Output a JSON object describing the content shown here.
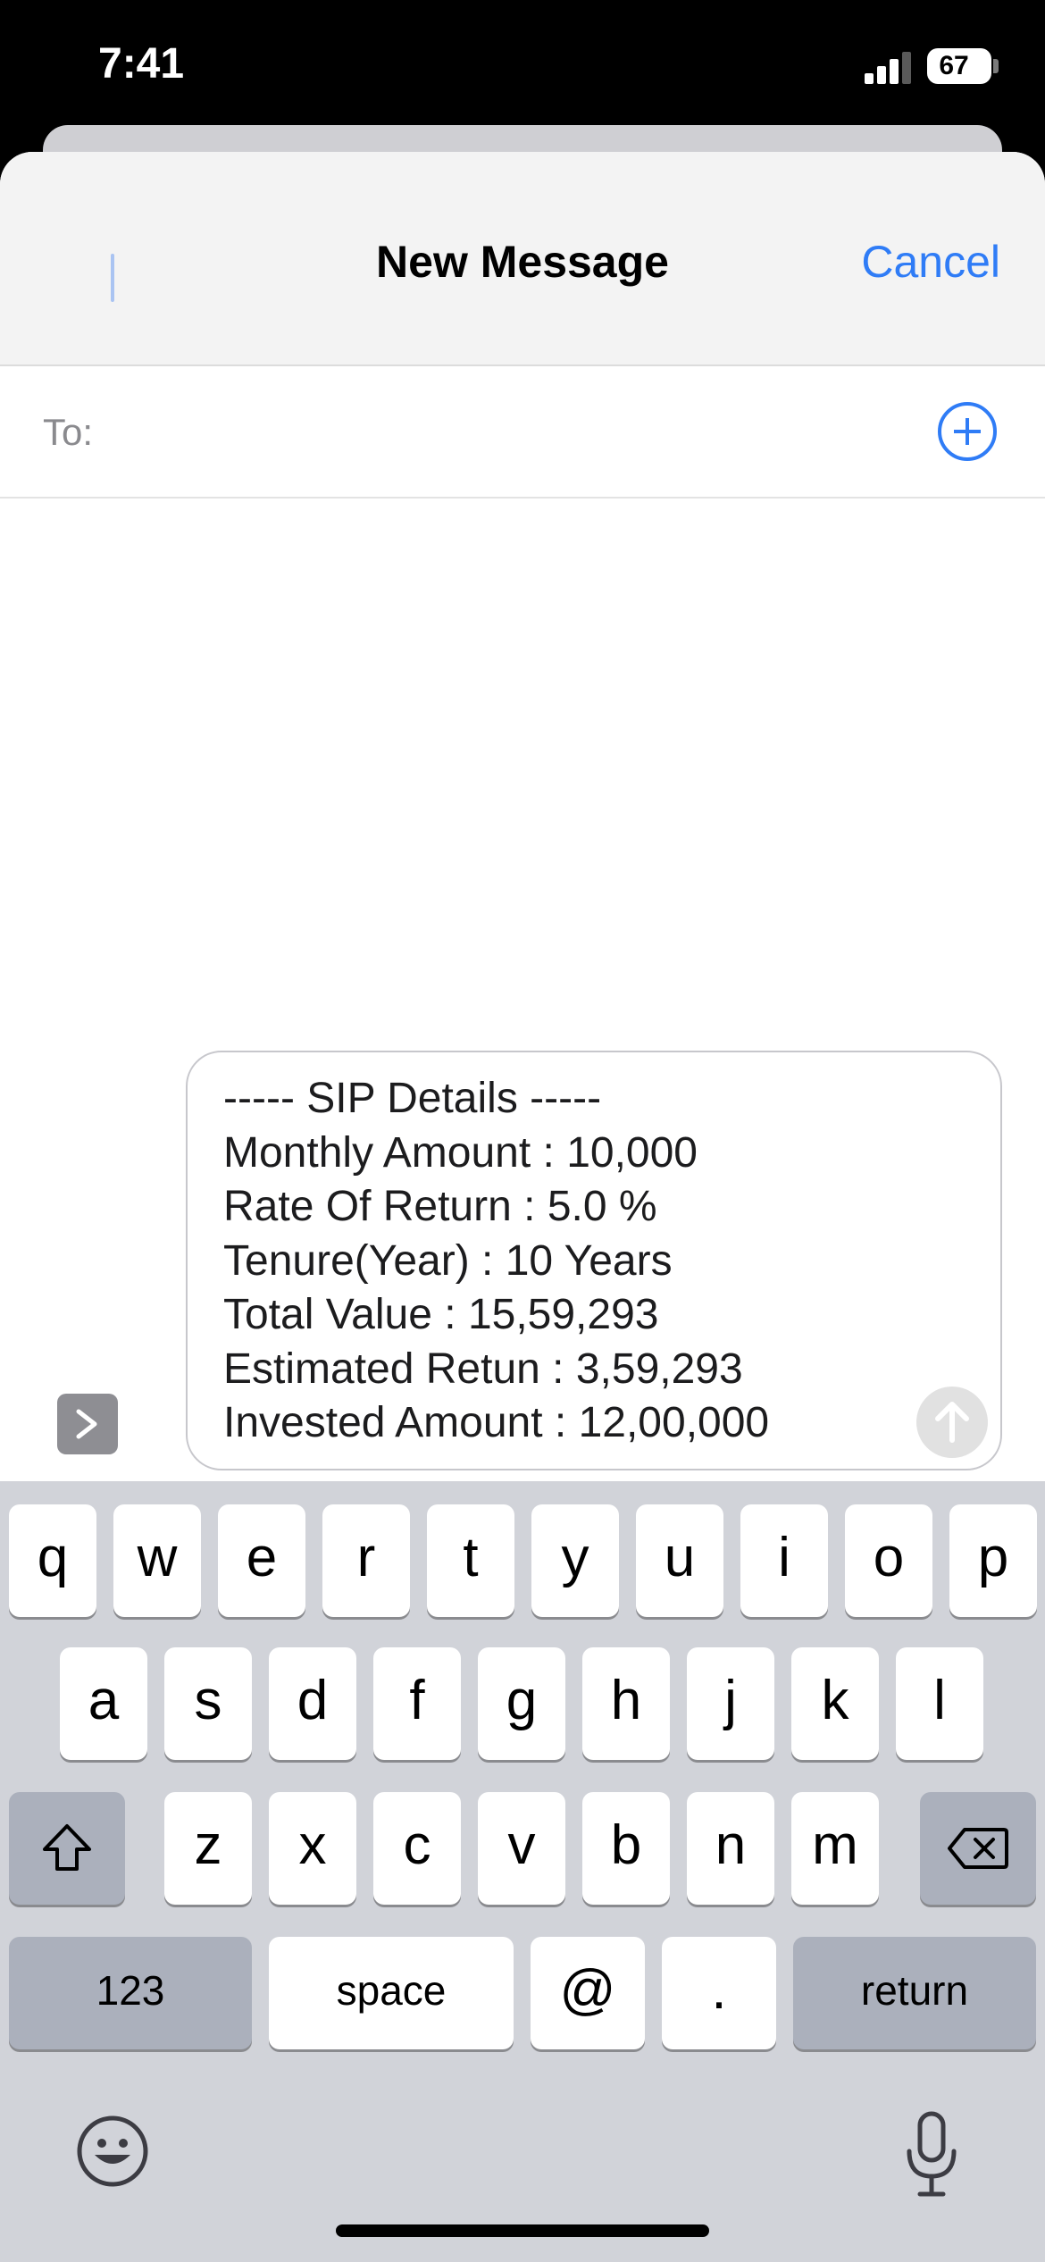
{
  "status_bar": {
    "time": "7:41",
    "battery": "67"
  },
  "header": {
    "title": "New Message",
    "cancel_label": "Cancel"
  },
  "recipient": {
    "label": "To:",
    "value": ""
  },
  "message": {
    "lines": [
      "----- SIP Details -----",
      "Monthly Amount : 10,000",
      "Rate Of Return : 5.0 %",
      "Tenure(Year) : 10 Years",
      "Total Value : 15,59,293",
      "Estimated Retun : 3,59,293",
      "Invested Amount : 12,00,000"
    ]
  },
  "keyboard": {
    "row1": [
      "q",
      "w",
      "e",
      "r",
      "t",
      "y",
      "u",
      "i",
      "o",
      "p"
    ],
    "row2": [
      "a",
      "s",
      "d",
      "f",
      "g",
      "h",
      "j",
      "k",
      "l"
    ],
    "row3": [
      "z",
      "x",
      "c",
      "v",
      "b",
      "n",
      "m"
    ],
    "numbers_label": "123",
    "space_label": "space",
    "at_label": "@",
    "dot_label": ".",
    "return_label": "return",
    "icons": {
      "shift": "shift-icon",
      "delete": "delete-icon",
      "emoji": "emoji-icon",
      "mic": "microphone-icon"
    }
  },
  "colors": {
    "accent": "#2f7cf6",
    "keyboard_bg": "#d1d3d9",
    "special_key": "#abb0bc"
  }
}
